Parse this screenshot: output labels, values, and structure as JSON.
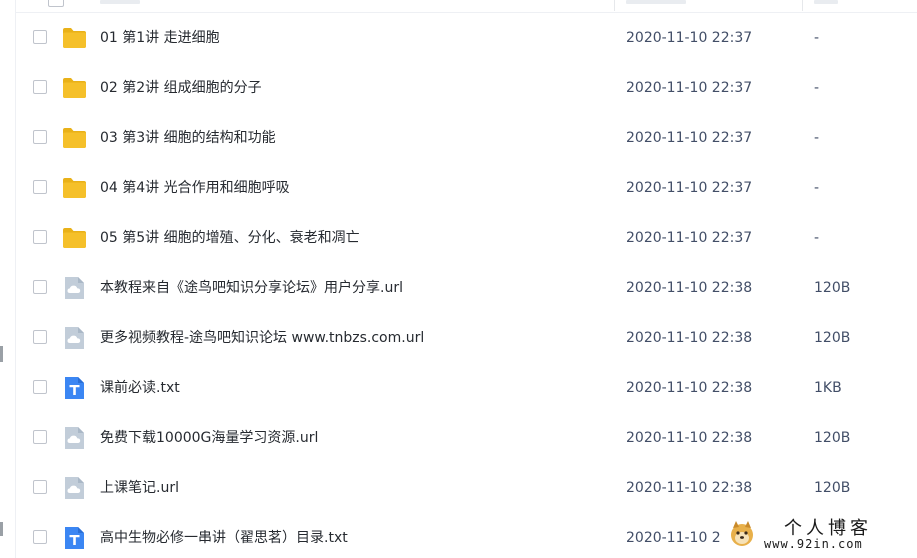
{
  "colors": {
    "folder": "#f5c02a",
    "folder_tab": "#e9b118",
    "url_icon": "#c2cdd9",
    "txt_icon": "#3b86f3",
    "text": "#262a30",
    "meta_text": "#424e67"
  },
  "files": [
    {
      "icon": "folder-icon",
      "name": "01 第1讲 走进细胞",
      "date": "2020-11-10 22:37",
      "size": "-"
    },
    {
      "icon": "folder-icon",
      "name": "02 第2讲 组成细胞的分子",
      "date": "2020-11-10 22:37",
      "size": "-"
    },
    {
      "icon": "folder-icon",
      "name": "03 第3讲 细胞的结构和功能",
      "date": "2020-11-10 22:37",
      "size": "-"
    },
    {
      "icon": "folder-icon",
      "name": "04 第4讲 光合作用和细胞呼吸",
      "date": "2020-11-10 22:37",
      "size": "-"
    },
    {
      "icon": "folder-icon",
      "name": "05 第5讲 细胞的增殖、分化、衰老和凋亡",
      "date": "2020-11-10 22:37",
      "size": "-"
    },
    {
      "icon": "url-file-icon",
      "name": "本教程来自《途鸟吧知识分享论坛》用户分享.url",
      "date": "2020-11-10 22:38",
      "size": "120B"
    },
    {
      "icon": "url-file-icon",
      "name": "更多视频教程-途鸟吧知识论坛 www.tnbzs.com.url",
      "date": "2020-11-10 22:38",
      "size": "120B"
    },
    {
      "icon": "txt-file-icon",
      "name": "课前必读.txt",
      "date": "2020-11-10 22:38",
      "size": "1KB"
    },
    {
      "icon": "url-file-icon",
      "name": "免费下载10000G海量学习资源.url",
      "date": "2020-11-10 22:38",
      "size": "120B"
    },
    {
      "icon": "url-file-icon",
      "name": "上课笔记.url",
      "date": "2020-11-10 22:38",
      "size": "120B"
    },
    {
      "icon": "txt-file-icon",
      "name": "高中生物必修一串讲（翟思茗）目录.txt",
      "date": "2020-11-10 2",
      "size": ""
    }
  ],
  "watermark": {
    "title": "个人博客",
    "url": "www.92in.com",
    "logo_icon": "doge-logo-icon"
  }
}
